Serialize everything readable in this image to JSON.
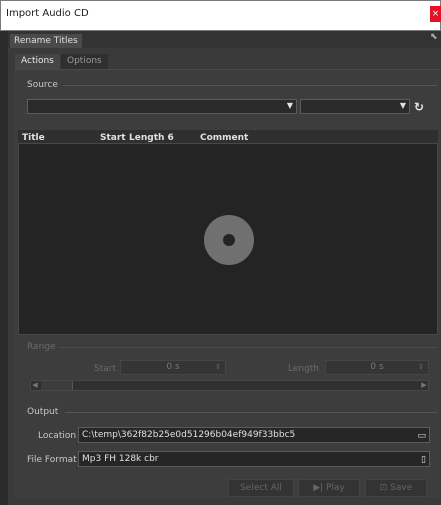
{
  "window": {
    "title": "Import Audio CD",
    "close_glyph": "×"
  },
  "toolbar": {
    "rename_titles": "Rename Titles",
    "pin_glyph": "⬉"
  },
  "tabs": [
    {
      "label": "Actions",
      "active": true
    },
    {
      "label": "Options",
      "active": false
    }
  ],
  "source": {
    "label": "Source",
    "device_value": "",
    "speed_value": "",
    "refresh_icon": "refresh-icon"
  },
  "table": {
    "columns": [
      "Title",
      "Start",
      "Length 6",
      "Comment"
    ],
    "rows": [],
    "empty_icon": "cd-disc-icon"
  },
  "range": {
    "label": "Range",
    "start_label": "Start",
    "start_value": "0 s",
    "length_label": "Length",
    "length_value": "0 s"
  },
  "output": {
    "label": "Output",
    "location_label": "Location",
    "location_value": "C:\\temp\\362f82b25e0d51296b04ef949f33bbc5",
    "format_label": "File Format",
    "format_value": "Mp3 FH 128k cbr"
  },
  "buttons": {
    "select_all": "Select All",
    "play": "Play",
    "save": "Save"
  },
  "colors": {
    "background": "#3a3a3a",
    "title_bar": "#ffffff",
    "close": "#e81123"
  }
}
